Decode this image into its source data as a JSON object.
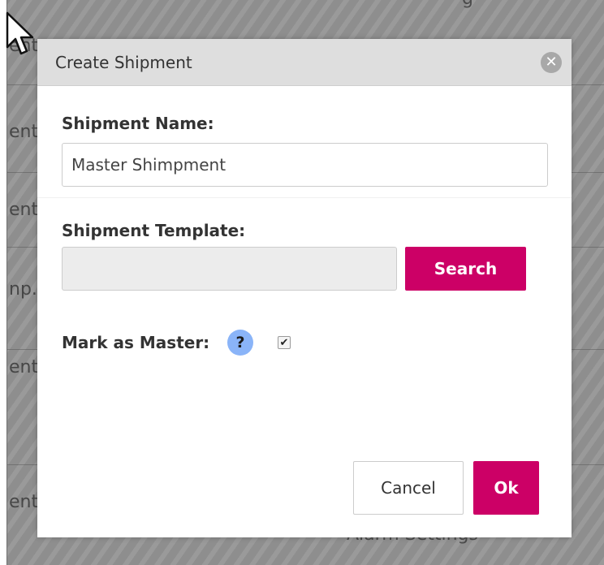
{
  "background_page": {
    "row_fragments": [
      "ent",
      "ent",
      "ent",
      "np.",
      "ent",
      "ent"
    ],
    "bottom_text": "Alarm Settings",
    "top_text": "g"
  },
  "modal": {
    "title": "Create Shipment",
    "close_icon": "close-icon",
    "fields": {
      "shipment_name": {
        "label": "Shipment Name:",
        "value": "Master Shimpment",
        "placeholder": ""
      },
      "shipment_template": {
        "label": "Shipment Template:",
        "value": "",
        "placeholder": "",
        "search_label": "Search"
      },
      "mark_as_master": {
        "label": "Mark as Master:",
        "help_text": "?",
        "checked": true,
        "check_glyph": "✔"
      }
    },
    "buttons": {
      "cancel_label": "Cancel",
      "ok_label": "Ok"
    }
  },
  "colors": {
    "primary": "#cc0066",
    "help_icon": "#8ab4f8",
    "header_bg": "#dedede",
    "overlay": "#8e8e8e"
  }
}
